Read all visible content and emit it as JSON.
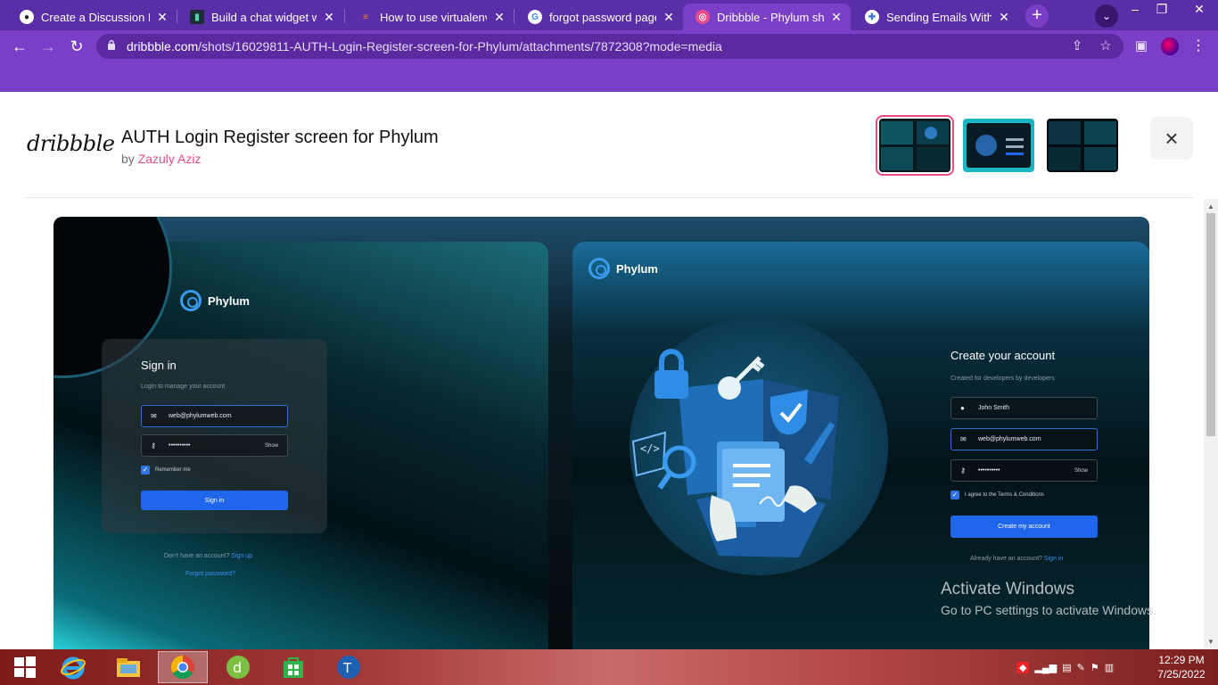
{
  "browser": {
    "tabs": [
      {
        "title": "Create a Discussion For",
        "favicon": "github-icon",
        "active": false
      },
      {
        "title": "Build a chat widget with",
        "favicon": "site-icon",
        "active": false
      },
      {
        "title": "How to use virtualenv w",
        "favicon": "stackoverflow-icon",
        "active": false
      },
      {
        "title": "forgot password page -",
        "favicon": "google-icon",
        "active": false
      },
      {
        "title": "Dribbble - Phylum shot",
        "favicon": "dribbble-icon",
        "active": true
      },
      {
        "title": "Sending Emails With Py",
        "favicon": "site-icon",
        "active": false
      }
    ],
    "url_host": "dribbble.com",
    "url_path": "/shots/16029811-AUTH-Login-Register-screen-for-Phylum/attachments/7872308?mode=media",
    "accent_color": "#7a3fc6"
  },
  "header": {
    "logo": "dribbble",
    "title": "AUTH Login Register screen for Phylum",
    "by_label": "by",
    "author": "Zazuly Aziz",
    "close_symbol": "×"
  },
  "shot": {
    "brand": "Phylum",
    "signin": {
      "title": "Sign in",
      "subtitle": "Login to manage your account",
      "email": "web@phylumweb.com",
      "password": "••••••••••",
      "show_label": "Show",
      "remember": "Remember me",
      "button": "Sign in",
      "no_account": "Don't have an account?",
      "signup_link": "Sign up",
      "forgot": "Forgot password?"
    },
    "register": {
      "title": "Create your account",
      "subtitle": "Created for developers by developers",
      "name": "John Smith",
      "email": "web@phylumweb.com",
      "password": "••••••••••",
      "show_label": "Show",
      "agree": "I agree to the Terms & Conditions",
      "button": "Create my account",
      "have_account": "Already have an account?",
      "signin_link": "Sign in"
    }
  },
  "watermark": {
    "line1": "Activate Windows",
    "line2": "Go to PC settings to activate Windows."
  },
  "taskbar": {
    "apps": [
      "windows-start-icon",
      "internet-explorer-icon",
      "file-explorer-icon",
      "chrome-icon",
      "dreamweaver-icon",
      "store-icon",
      "app-icon"
    ],
    "time": "12:29 PM",
    "date": "7/25/2022"
  }
}
